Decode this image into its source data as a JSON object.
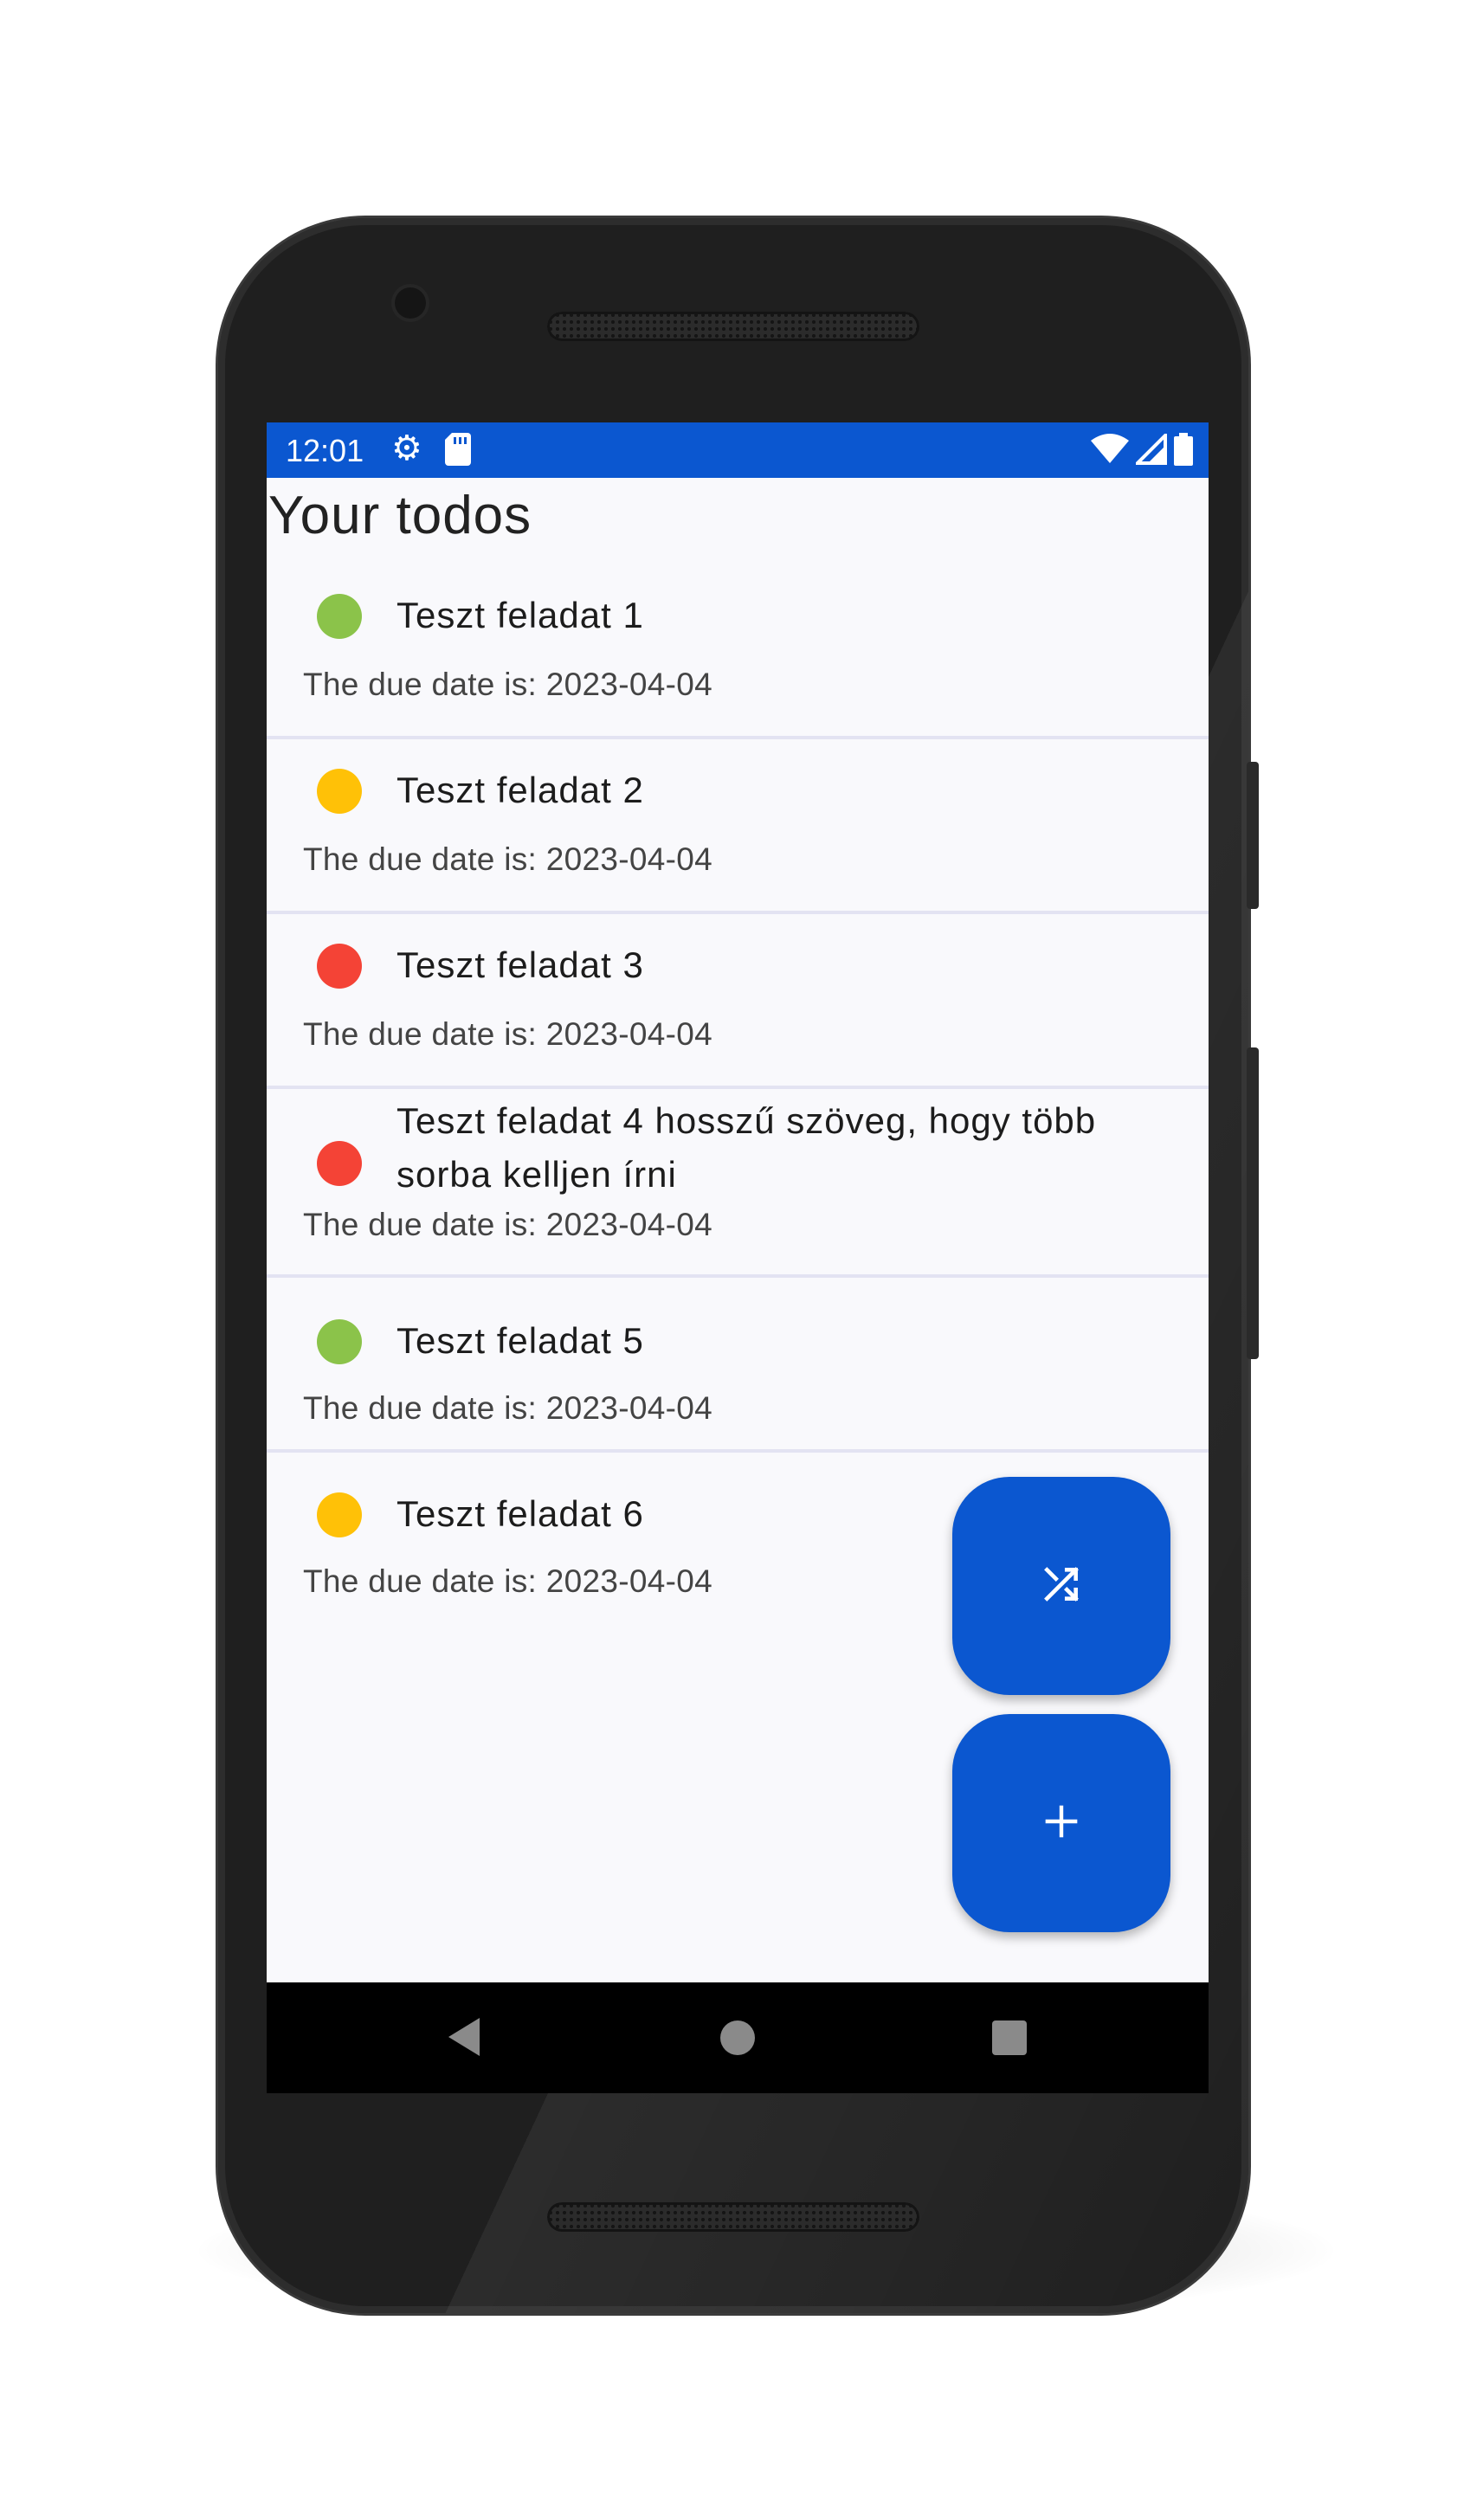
{
  "status_bar": {
    "time": "12:01",
    "icons": [
      "gear-icon",
      "sd-card-icon",
      "wifi-icon",
      "cell-signal-icon",
      "battery-icon"
    ]
  },
  "header": {
    "title": "Your todos"
  },
  "todos": [
    {
      "title": "Teszt feladat 1",
      "due": "The due date is: 2023-04-04",
      "priority_color": "#8bc34a"
    },
    {
      "title": "Teszt feladat 2",
      "due": "The due date is: 2023-04-04",
      "priority_color": "#ffc107"
    },
    {
      "title": "Teszt feladat 3",
      "due": "The due date is: 2023-04-04",
      "priority_color": "#f44336"
    },
    {
      "title": "Teszt feladat 4 hosszű szöveg, hogy több sorba kelljen írni",
      "due": "The due date is: 2023-04-04",
      "priority_color": "#f44336"
    },
    {
      "title": "Teszt feladat 5",
      "due": "The due date is: 2023-04-04",
      "priority_color": "#8bc34a"
    },
    {
      "title": "Teszt feladat 6",
      "due": "The due date is: 2023-04-04",
      "priority_color": "#ffc107"
    }
  ],
  "fabs": [
    {
      "icon": "shuffle-icon"
    },
    {
      "icon": "plus-icon"
    }
  ],
  "nav_bar": {
    "icons": [
      "back-icon",
      "home-icon",
      "recents-icon"
    ]
  },
  "colors": {
    "primary": "#0b57d0",
    "background": "#f9f9fc",
    "divider": "#e3e3f2"
  }
}
